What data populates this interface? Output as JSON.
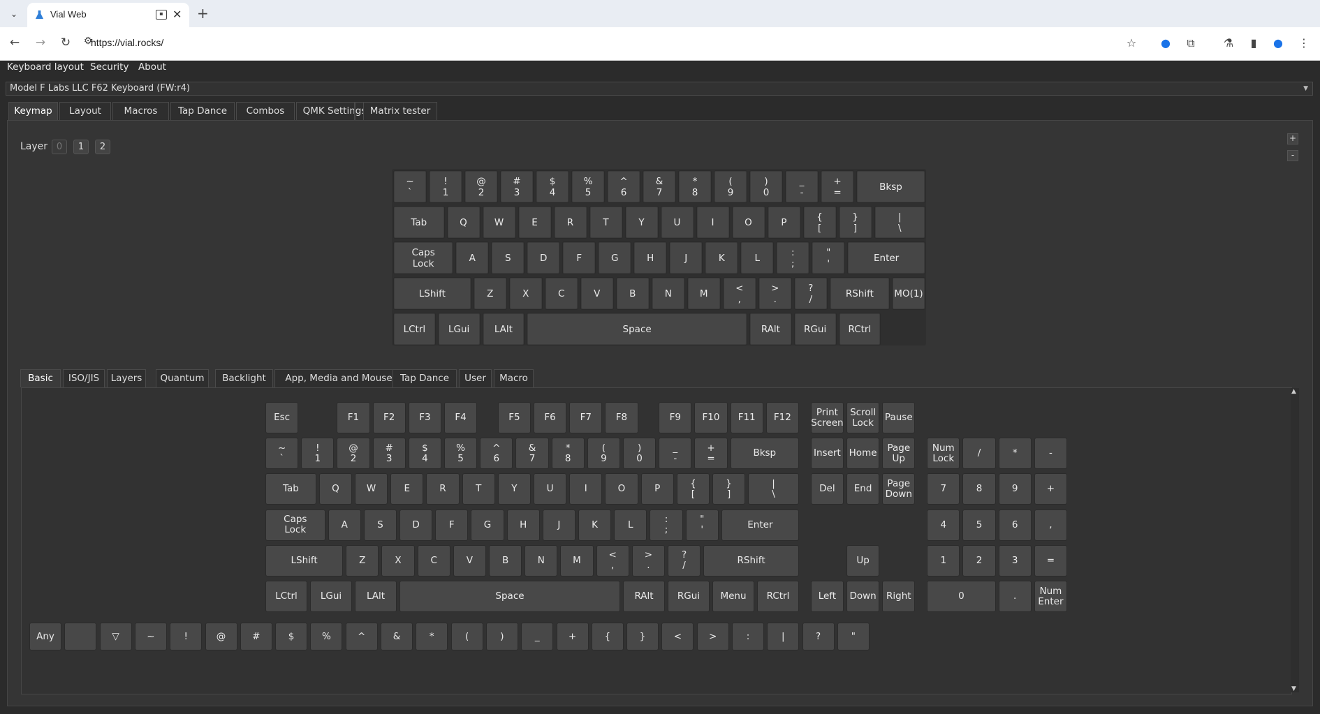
{
  "browser": {
    "tab_title": "Vial Web",
    "url": "https://vial.rocks/"
  },
  "menu": [
    "Keyboard layout",
    "Security",
    "About"
  ],
  "device": "Model F Labs LLC F62 Keyboard (FW:r4)",
  "tabs": [
    "Keymap",
    "Layout",
    "Macros",
    "Tap Dance",
    "Combos",
    "QMK Settings",
    "Matrix tester"
  ],
  "layer": {
    "label": "Layer",
    "items": [
      "0",
      "1",
      "2"
    ],
    "active": "0"
  },
  "zoom": {
    "plus": "+",
    "minus": "-"
  },
  "keymap_rows": [
    [
      "~\n`",
      "!\n1",
      "@\n2",
      "#\n3",
      "$\n4",
      "%\n5",
      "^\n6",
      "&\n7",
      "*\n8",
      "(\n9",
      ")\n0",
      "_\n-",
      "+\n=",
      "Bksp"
    ],
    [
      "Tab",
      "Q",
      "W",
      "E",
      "R",
      "T",
      "Y",
      "U",
      "I",
      "O",
      "P",
      "{\n[",
      "}\n]",
      "|\n\\"
    ],
    [
      "Caps\nLock",
      "A",
      "S",
      "D",
      "F",
      "G",
      "H",
      "J",
      "K",
      "L",
      ":\n;",
      "\"\n'",
      "Enter"
    ],
    [
      "LShift",
      "Z",
      "X",
      "C",
      "V",
      "B",
      "N",
      "M",
      "<\n,",
      ">\n.",
      "?\n/",
      "RShift",
      "MO(1)"
    ],
    [
      "LCtrl",
      "LGui",
      "LAlt",
      "Space",
      "RAlt",
      "RGui",
      "RCtrl"
    ]
  ],
  "keycode_tabs": [
    "Basic",
    "ISO/JIS",
    "Layers",
    "Quantum",
    "Backlight",
    "App, Media and Mouse",
    "Tap Dance",
    "User",
    "Macro"
  ],
  "picker_rows": [
    [
      "Esc",
      "F1",
      "F2",
      "F3",
      "F4",
      "F5",
      "F6",
      "F7",
      "F8",
      "F9",
      "F10",
      "F11",
      "F12",
      "Print\nScreen",
      "Scroll\nLock",
      "Pause"
    ],
    [
      "~\n`",
      "!\n1",
      "@\n2",
      "#\n3",
      "$\n4",
      "%\n5",
      "^\n6",
      "&\n7",
      "*\n8",
      "(\n9",
      ")\n0",
      "_\n-",
      "+\n=",
      "Bksp",
      "Insert",
      "Home",
      "Page\nUp",
      "Num\nLock",
      "/",
      "*",
      "-"
    ],
    [
      "Tab",
      "Q",
      "W",
      "E",
      "R",
      "T",
      "Y",
      "U",
      "I",
      "O",
      "P",
      "{\n[",
      "}\n]",
      "|\n\\",
      "Del",
      "End",
      "Page\nDown",
      "7",
      "8",
      "9",
      "+"
    ],
    [
      "Caps\nLock",
      "A",
      "S",
      "D",
      "F",
      "G",
      "H",
      "J",
      "K",
      "L",
      ":\n;",
      "\"\n'",
      "Enter",
      "4",
      "5",
      "6",
      ","
    ],
    [
      "LShift",
      "Z",
      "X",
      "C",
      "V",
      "B",
      "N",
      "M",
      "<\n,",
      ">\n.",
      "?\n/",
      "RShift",
      "Up",
      "1",
      "2",
      "3",
      "="
    ],
    [
      "LCtrl",
      "LGui",
      "LAlt",
      "Space",
      "RAlt",
      "RGui",
      "Menu",
      "RCtrl",
      "Left",
      "Down",
      "Right",
      "0",
      ".",
      "Num\nEnter"
    ]
  ],
  "special_row": [
    "Any",
    "",
    "▽",
    "~",
    "!",
    "@",
    "#",
    "$",
    "%",
    "^",
    "&",
    "*",
    "(",
    ")",
    "_",
    "+",
    "{",
    "}",
    "<",
    ">",
    ":",
    "|",
    "?",
    "\""
  ]
}
